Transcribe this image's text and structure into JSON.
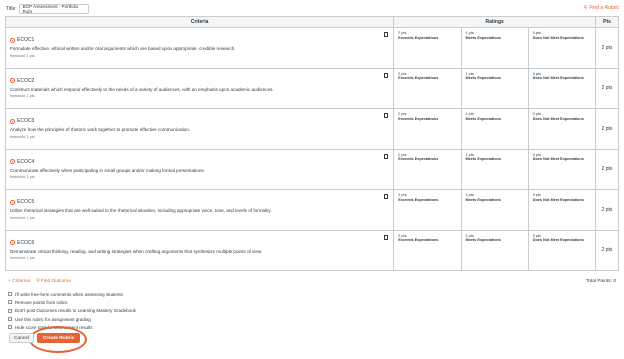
{
  "title": {
    "label": "Title:",
    "value": "BGP Assessment - Portfolio Rubr"
  },
  "find_rubric": "Find a Rubric",
  "headers": {
    "criteria": "Criteria",
    "ratings": "Ratings",
    "pts": "Pts"
  },
  "criteria": [
    {
      "code": "ECOC1",
      "description": "Formulate effective, ethical written and/or oral arguments which are based upon appropriate, credible research.",
      "threshold": "threshold: 1 pts",
      "ratings": [
        {
          "points": "2 pts",
          "label": "Exceeds Expectations"
        },
        {
          "points": "1 pts",
          "label": "Meets Expectations"
        },
        {
          "points": "0 pts",
          "label": "Does Not Meet Expectations"
        }
      ],
      "pts": "2 pts"
    },
    {
      "code": "ECOC2",
      "description": "Construct materials which respond effectively to the needs of a variety of audiences, with an emphasis upon academic audiences.",
      "threshold": "threshold: 1 pts",
      "ratings": [
        {
          "points": "2 pts",
          "label": "Exceeds Expectations"
        },
        {
          "points": "1 pts",
          "label": "Meets Expectations"
        },
        {
          "points": "0 pts",
          "label": "Does Not Meet Expectations"
        }
      ],
      "pts": "2 pts"
    },
    {
      "code": "ECOC3",
      "description": "Analyze how the principles of rhetoric work together to promote effective communication.",
      "threshold": "threshold: 1 pts",
      "ratings": [
        {
          "points": "2 pts",
          "label": "Exceeds Expectations"
        },
        {
          "points": "1 pts",
          "label": "Meets Expectations"
        },
        {
          "points": "0 pts",
          "label": "Does Not Meet Expectations"
        }
      ],
      "pts": "2 pts"
    },
    {
      "code": "ECOC4",
      "description": "Communicate effectively when participating in small groups and/or making formal presentations.",
      "threshold": "threshold: 1 pts",
      "ratings": [
        {
          "points": "2 pts",
          "label": "Exceeds Expectations"
        },
        {
          "points": "1 pts",
          "label": "Meets Expectations"
        },
        {
          "points": "0 pts",
          "label": "Does Not Meet Expectations"
        }
      ],
      "pts": "2 pts"
    },
    {
      "code": "ECOC5",
      "description": "Utilize rhetorical strategies that are well-suited to the rhetorical situation, including appropriate voice, tone, and levels of formality.",
      "threshold": "threshold: 1 pts",
      "ratings": [
        {
          "points": "2 pts",
          "label": "Exceeds Expectations"
        },
        {
          "points": "1 pts",
          "label": "Meets Expectations"
        },
        {
          "points": "0 pts",
          "label": "Does Not Meet Expectations"
        }
      ],
      "pts": "2 pts"
    },
    {
      "code": "ECOC6",
      "description": "Demonstrate critical thinking, reading, and writing strategies when crafting arguments that synthesize multiple points of view.",
      "threshold": "threshold: 1 pts",
      "ratings": [
        {
          "points": "2 pts",
          "label": "Exceeds Expectations"
        },
        {
          "points": "1 pts",
          "label": "Meets Expectations"
        },
        {
          "points": "0 pts",
          "label": "Does Not Meet Expectations"
        }
      ],
      "pts": "2 pts"
    }
  ],
  "footer": {
    "criterion": "+ Criterion",
    "find_outcome": "Find Outcome",
    "total": "Total Points: 0"
  },
  "options": [
    "I'll write free-form comments when assessing students",
    "Remove points from rubric",
    "Don't post Outcomes results to Learning Mastery Gradebook",
    "Use this rubric for assignment grading",
    "Hide score total for assessment results"
  ],
  "buttons": {
    "cancel": "Cancel",
    "create": "Create Rubric"
  },
  "colors": {
    "accent": "#e66135",
    "border": "#c7cdd1",
    "text": "#2d3b45"
  }
}
